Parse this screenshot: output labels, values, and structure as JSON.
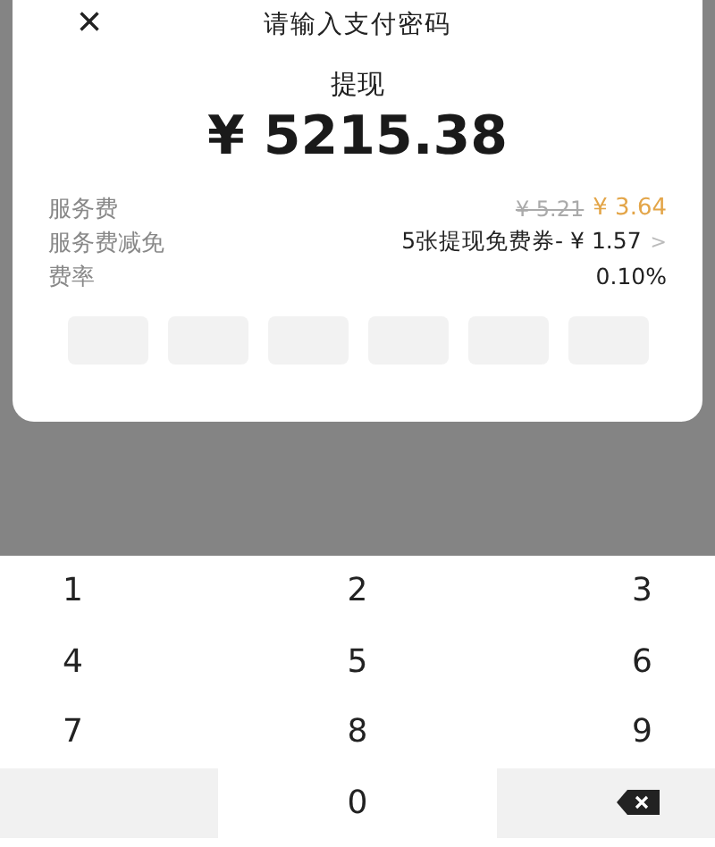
{
  "dialog": {
    "close_icon": "×",
    "title": "请输入支付密码",
    "label": "提现",
    "amount": "¥ 5215.38",
    "fees": [
      {
        "kind": "discounted",
        "label": "服务费",
        "original": "¥ 5.21",
        "value": "¥ 3.64"
      },
      {
        "kind": "link",
        "label": "服务费减免",
        "value": "5张提现免费券- ¥ 1.57",
        "chevron": ">"
      },
      {
        "kind": "plain",
        "label": "费率",
        "value": "0.10%"
      }
    ],
    "password_boxes": [
      {
        "filled": false
      },
      {
        "filled": false
      },
      {
        "filled": false
      },
      {
        "filled": false
      },
      {
        "filled": false
      },
      {
        "filled": false
      }
    ]
  },
  "keypad": [
    {
      "kind": "digit",
      "label": "1"
    },
    {
      "kind": "digit",
      "label": "2"
    },
    {
      "kind": "digit",
      "label": "3"
    },
    {
      "kind": "digit",
      "label": "4"
    },
    {
      "kind": "digit",
      "label": "5"
    },
    {
      "kind": "digit",
      "label": "6"
    },
    {
      "kind": "digit",
      "label": "7"
    },
    {
      "kind": "digit",
      "label": "8"
    },
    {
      "kind": "digit",
      "label": "9"
    },
    {
      "kind": "blank"
    },
    {
      "kind": "digit",
      "label": "0"
    },
    {
      "kind": "backspace"
    }
  ]
}
